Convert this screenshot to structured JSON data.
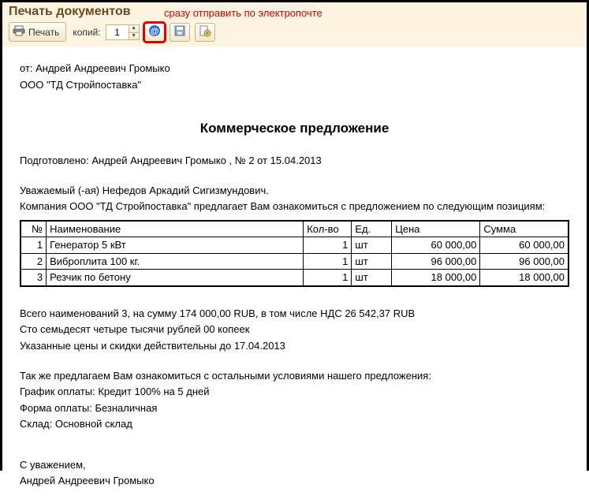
{
  "titlebar": {
    "title": "Печать документов"
  },
  "annotation": "сразу отправить по электропочте",
  "toolbar": {
    "print_label": "Печать",
    "copies_label": "копий:",
    "copies_value": "1"
  },
  "document": {
    "from_line": "от: Андрей Андреевич Громыко",
    "company_line": "ООО \"ТД Стройпоставка\"",
    "title": "Коммерческое предложение",
    "prepared_line": "Подготовлено: Андрей Андреевич Громыко , № 2 от 15.04.2013",
    "greeting": "Уважаемый (-ая) Нефедов Аркадий Сигизмундович.",
    "intro": "Компания ООО \"ТД Стройпоставка\" предлагает Вам ознакомиться с предложением по следующим позициям:",
    "table": {
      "headers": {
        "n": "№",
        "name": "Наименование",
        "qty": "Кол-во",
        "unit": "Ед.",
        "price": "Цена",
        "sum": "Сумма"
      },
      "rows": [
        {
          "n": "1",
          "name": "Генератор 5 кВт",
          "qty": "1",
          "unit": "шт",
          "price": "60 000,00",
          "sum": "60 000,00"
        },
        {
          "n": "2",
          "name": "Виброплита 100 кг.",
          "qty": "1",
          "unit": "шт",
          "price": "96 000,00",
          "sum": "96 000,00"
        },
        {
          "n": "3",
          "name": "Резчик по бетону",
          "qty": "1",
          "unit": "шт",
          "price": "18 000,00",
          "sum": "18 000,00"
        }
      ]
    },
    "total_line": "Всего наименований 3, на сумму 174 000,00 RUB, в том числе НДС 26 542,37 RUB",
    "amount_words": "Сто семьдесят четыре тысячи рублей 00 копеек",
    "valid_line": "Указанные цены и скидки действительны до 17.04.2013",
    "conditions_intro": "Так же предлагаем Вам ознакомиться с остальными условиями нашего предложения:",
    "pay_schedule": "График оплаты: Кредит 100% на 5 дней",
    "pay_form": "Форма оплаты: Безналичная",
    "warehouse": "Склад: Основной склад",
    "regards": "С уважением,",
    "signer": "Андрей Андреевич Громыко"
  }
}
